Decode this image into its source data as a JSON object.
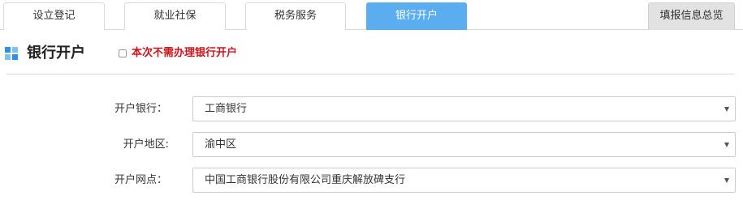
{
  "tabs": [
    {
      "label": "设立登记"
    },
    {
      "label": "就业社保"
    },
    {
      "label": "税务服务"
    },
    {
      "label": "银行开户"
    }
  ],
  "summary_tab": {
    "label": "填报信息总览"
  },
  "active_tab": "银行开户",
  "section": {
    "icon": "grid-icon",
    "title": "银行开户",
    "skip_checkbox": {
      "label": "本次不需办理银行开户",
      "checked": false
    }
  },
  "form": {
    "bank": {
      "label": "开户银行：",
      "value": "工商银行"
    },
    "region": {
      "label": "开户地区:",
      "value": "渝中区"
    },
    "branch": {
      "label": "开户网点：",
      "value": "中国工商银行股份有限公司重庆解放碑支行"
    }
  },
  "colors": {
    "active_tab": "#5aaef0",
    "summary_tab": "#e2e2e2",
    "warning_text": "#c8161d",
    "icon": "#2f8fe0"
  }
}
